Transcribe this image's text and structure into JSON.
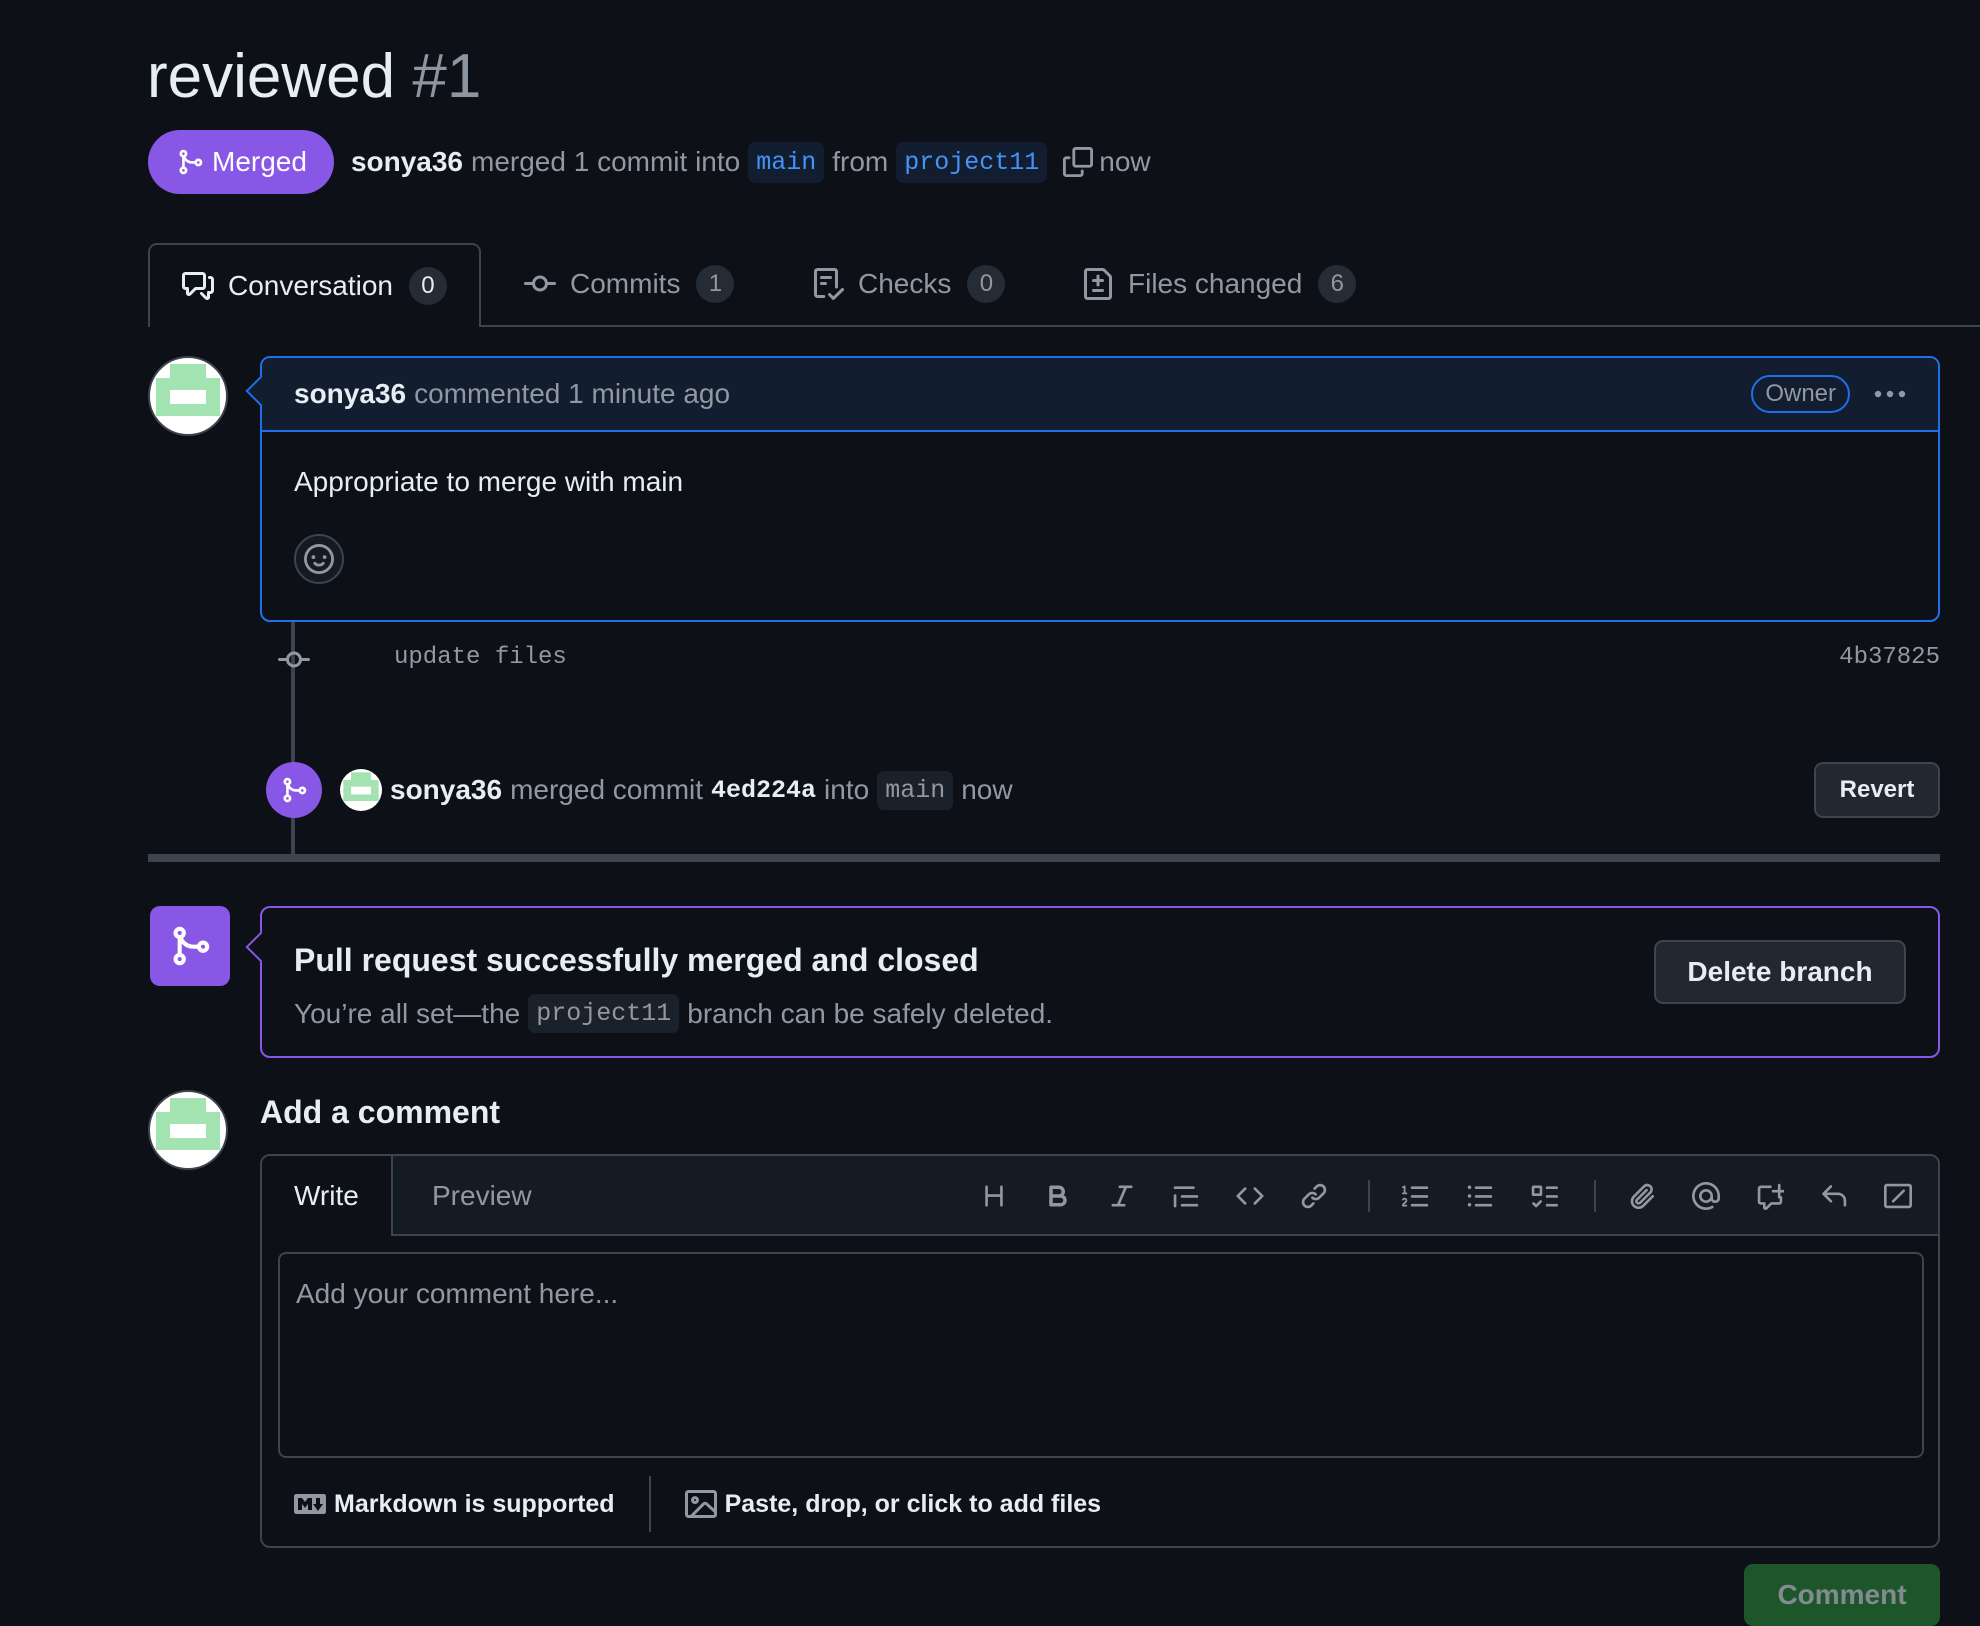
{
  "pr": {
    "title": "reviewed",
    "number": "#1",
    "state_label": "Merged",
    "author": "sonya36",
    "merged_text": "merged 1 commit into",
    "base_branch": "main",
    "from_text": "from",
    "head_branch": "project11",
    "time": "now"
  },
  "tabs": [
    {
      "label": "Conversation",
      "count": "0",
      "icon": "comment-discussion-icon"
    },
    {
      "label": "Commits",
      "count": "1",
      "icon": "git-commit-icon"
    },
    {
      "label": "Checks",
      "count": "0",
      "icon": "checklist-icon"
    },
    {
      "label": "Files changed",
      "count": "6",
      "icon": "file-diff-icon"
    }
  ],
  "comment": {
    "author": "sonya36",
    "meta": "commented 1 minute ago",
    "role": "Owner",
    "body": "Appropriate to merge with main"
  },
  "commit": {
    "message": "update files",
    "sha": "4b37825"
  },
  "merge_event": {
    "author": "sonya36",
    "text1": "merged commit",
    "sha": "4ed224a",
    "text2": "into",
    "branch": "main",
    "time": "now",
    "revert_label": "Revert"
  },
  "merged_notice": {
    "title": "Pull request successfully merged and closed",
    "sub_before": "You’re all set—the",
    "branch": "project11",
    "sub_after": "branch can be safely deleted.",
    "delete_label": "Delete branch"
  },
  "composer": {
    "heading": "Add a comment",
    "write_tab": "Write",
    "preview_tab": "Preview",
    "placeholder": "Add your comment here...",
    "markdown_note": "Markdown is supported",
    "files_note": "Paste, drop, or click to add files",
    "submit_label": "Comment"
  },
  "colors": {
    "background": "#0d1117",
    "merged_purple": "#8957e5",
    "accent_blue": "#1f6feb",
    "border": "#3d444d"
  }
}
